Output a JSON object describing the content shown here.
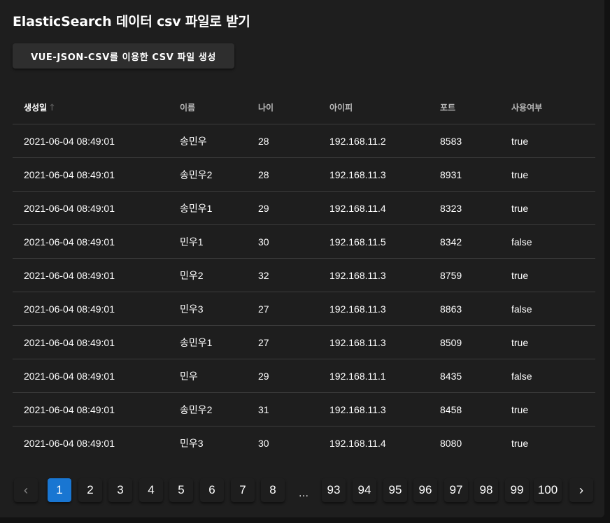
{
  "page": {
    "title": "ElasticSearch 데이터 csv 파일로 받기",
    "csv_button_label": "VUE-JSON-CSV를 이용한 CSV 파일 생성"
  },
  "table": {
    "headers": [
      "생성일",
      "이름",
      "나이",
      "아이피",
      "포트",
      "사용여부"
    ],
    "sort_column": "생성일",
    "sort_direction": "ascending",
    "rows": [
      [
        "2021-06-04 08:49:01",
        "송민우",
        "28",
        "192.168.11.2",
        "8583",
        "true"
      ],
      [
        "2021-06-04 08:49:01",
        "송민우2",
        "28",
        "192.168.11.3",
        "8931",
        "true"
      ],
      [
        "2021-06-04 08:49:01",
        "송민우1",
        "29",
        "192.168.11.4",
        "8323",
        "true"
      ],
      [
        "2021-06-04 08:49:01",
        "민우1",
        "30",
        "192.168.11.5",
        "8342",
        "false"
      ],
      [
        "2021-06-04 08:49:01",
        "민우2",
        "32",
        "192.168.11.3",
        "8759",
        "true"
      ],
      [
        "2021-06-04 08:49:01",
        "민우3",
        "27",
        "192.168.11.3",
        "8863",
        "false"
      ],
      [
        "2021-06-04 08:49:01",
        "송민우1",
        "27",
        "192.168.11.3",
        "8509",
        "true"
      ],
      [
        "2021-06-04 08:49:01",
        "민우",
        "29",
        "192.168.11.1",
        "8435",
        "false"
      ],
      [
        "2021-06-04 08:49:01",
        "송민우2",
        "31",
        "192.168.11.3",
        "8458",
        "true"
      ],
      [
        "2021-06-04 08:49:01",
        "민우3",
        "30",
        "192.168.11.4",
        "8080",
        "true"
      ]
    ]
  },
  "pagination": {
    "prev_icon": "chevron-left-icon",
    "next_icon": "chevron-right-icon",
    "current": "1",
    "pages": [
      "1",
      "2",
      "3",
      "4",
      "5",
      "6",
      "7",
      "8",
      "…",
      "93",
      "94",
      "95",
      "96",
      "97",
      "98",
      "99",
      "100"
    ]
  },
  "colors": {
    "background": "#1e1e1e",
    "accent": "#1976d2",
    "divider": "#3b3b3b"
  }
}
